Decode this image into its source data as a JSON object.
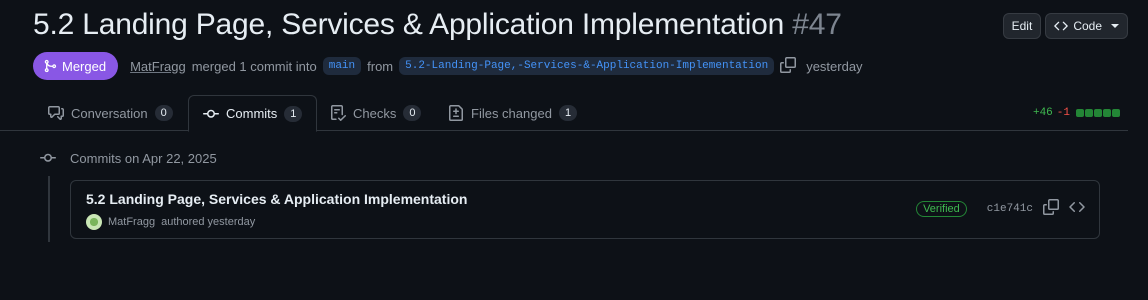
{
  "header": {
    "title": "5.2 Landing Page, Services & Application Implementation",
    "number": "#47",
    "edit_label": "Edit",
    "code_label": "Code"
  },
  "meta": {
    "status": "Merged",
    "author": "MatFragg",
    "merge_text": "merged 1 commit into",
    "base_branch": "main",
    "from_text": "from",
    "head_branch": "5.2-Landing-Page,-Services-&-Application-Implementation",
    "time": "yesterday"
  },
  "tabs": [
    {
      "label": "Conversation",
      "count": "0",
      "icon": "comment-icon"
    },
    {
      "label": "Commits",
      "count": "1",
      "icon": "commit-icon"
    },
    {
      "label": "Checks",
      "count": "0",
      "icon": "checklist-icon"
    },
    {
      "label": "Files changed",
      "count": "1",
      "icon": "file-diff-icon"
    }
  ],
  "diffstat": {
    "additions": "+46",
    "deletions": "-1"
  },
  "timeline": {
    "heading": "Commits on Apr 22, 2025",
    "commits": [
      {
        "title": "5.2 Landing Page, Services & Application Implementation",
        "author": "MatFragg",
        "authored_text": "authored yesterday",
        "badge": "Verified",
        "sha": "c1e741c"
      }
    ]
  },
  "colors": {
    "merged": "#8957e5",
    "verified": "#3fb950",
    "additions": "#3fb950",
    "deletions": "#f85149"
  }
}
